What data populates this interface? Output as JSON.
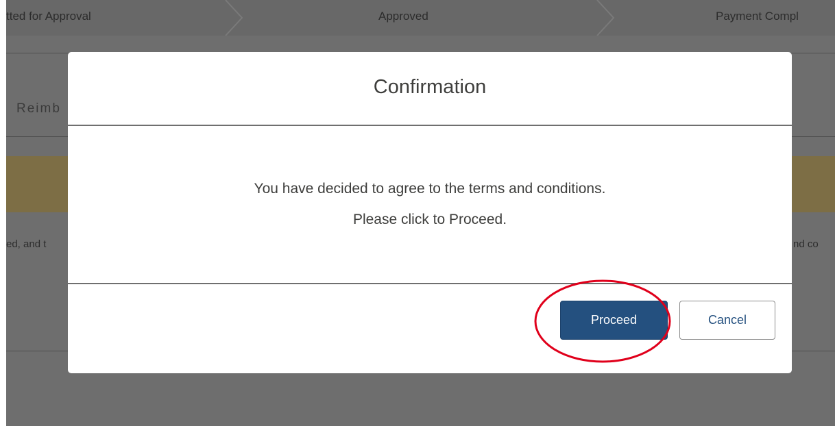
{
  "background": {
    "progress_steps": [
      "tted for Approval",
      "Approved",
      "Payment Compl"
    ],
    "tab_label": "Reimb",
    "para_left": "ed, and t",
    "para_right": "nd co"
  },
  "modal": {
    "title": "Confirmation",
    "message_line1": "You have decided to agree to the terms and conditions.",
    "message_line2": "Please click to Proceed.",
    "proceed_label": "Proceed",
    "cancel_label": "Cancel"
  },
  "colors": {
    "overlay": "#6e6e6e",
    "banner": "#7d6e45",
    "primary": "#24507f",
    "highlight": "#e0001b"
  }
}
